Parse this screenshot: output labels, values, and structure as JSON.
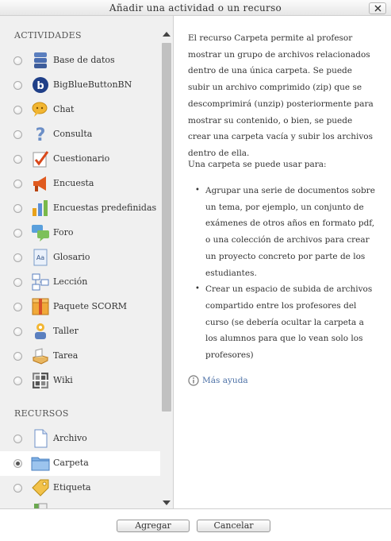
{
  "dialog": {
    "title": "Añadir una actividad o un recurso"
  },
  "activities": {
    "label": "ACTIVIDADES",
    "items": [
      {
        "label": "Base de datos",
        "icon": "database-icon"
      },
      {
        "label": "BigBlueButtonBN",
        "icon": "bigbluebutton-icon"
      },
      {
        "label": "Chat",
        "icon": "chat-icon"
      },
      {
        "label": "Consulta",
        "icon": "question-icon"
      },
      {
        "label": "Cuestionario",
        "icon": "quiz-icon"
      },
      {
        "label": "Encuesta",
        "icon": "megaphone-icon"
      },
      {
        "label": "Encuestas predefinidas",
        "icon": "bar-chart-icon"
      },
      {
        "label": "Foro",
        "icon": "forum-icon"
      },
      {
        "label": "Glosario",
        "icon": "glossary-icon"
      },
      {
        "label": "Lección",
        "icon": "lesson-icon"
      },
      {
        "label": "Paquete SCORM",
        "icon": "package-icon"
      },
      {
        "label": "Taller",
        "icon": "workshop-icon"
      },
      {
        "label": "Tarea",
        "icon": "assignment-icon"
      },
      {
        "label": "Wiki",
        "icon": "wiki-icon"
      }
    ]
  },
  "resources": {
    "label": "RECURSOS",
    "items": [
      {
        "label": "Archivo",
        "icon": "file-icon",
        "selected": false
      },
      {
        "label": "Carpeta",
        "icon": "folder-icon",
        "selected": true
      },
      {
        "label": "Etiqueta",
        "icon": "label-icon",
        "selected": false
      }
    ]
  },
  "description": {
    "intro": "El recurso Carpeta permite al profesor mostrar un grupo de archivos relacionados dentro de una única carpeta. Se puede subir un archivo comprimido (zip) que se descomprimirá (unzip) posteriormente para mostrar su contenido, o bien, se puede crear una carpeta vacía y subir los archivos dentro de ella.",
    "uses_heading": "Una carpeta se puede usar para:",
    "uses": [
      "Agrupar una serie de documentos sobre un tema, por ejemplo, un conjunto de exámenes de otros años en formato pdf, o una colección de archivos para crear un proyecto concreto por parte de los estudiantes.",
      "Crear un espacio de subida de archivos compartido entre los profesores del curso (se debería ocultar la carpeta a los alumnos para que lo vean solo los profesores)"
    ],
    "more_help": "Más ayuda"
  },
  "buttons": {
    "add": "Agregar",
    "cancel": "Cancelar"
  },
  "colors": {
    "link": "#4a6fa5",
    "panel_bg": "#f0f0f0",
    "selected_bg": "#ffffff"
  }
}
